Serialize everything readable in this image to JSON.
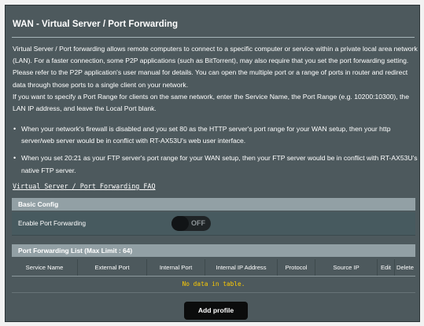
{
  "page": {
    "title": "WAN - Virtual Server / Port Forwarding",
    "description_1": "Virtual Server / Port forwarding allows remote computers to connect to a specific computer or service within a private local area network (LAN). For a faster connection, some P2P applications (such as BitTorrent), may also require that you set the port forwarding setting. Please refer to the P2P application's user manual for details. You can open the multiple port or a range of ports in router and redirect data through those ports to a single client on your network.",
    "description_2": "If you want to specify a Port Range for clients on the same network, enter the Service Name, the Port Range (e.g. 10200:10300), the LAN IP address, and leave the Local Port blank.",
    "bullets": [
      "When your network's firewall is disabled and you set 80 as the HTTP server's port range for your WAN setup, then your http server/web server would be in conflict with RT-AX53U's web user interface.",
      "When you set 20:21 as your FTP server's port range for your WAN setup, then your FTP server would be in conflict with RT-AX53U's native FTP server."
    ],
    "faq_link": "Virtual Server / Port Forwarding FAQ"
  },
  "basic_config": {
    "header": "Basic Config",
    "enable_label": "Enable Port Forwarding",
    "toggle_state": "OFF"
  },
  "list": {
    "header": "Port Forwarding List (Max Limit : 64)",
    "columns": [
      "Service Name",
      "External Port",
      "Internal Port",
      "Internal IP Address",
      "Protocol",
      "Source IP",
      "Edit",
      "Delete"
    ],
    "empty_message": "No data in table."
  },
  "actions": {
    "add_profile": "Add profile"
  },
  "colors": {
    "panel_bg": "#4d595d",
    "section_header_bg": "#92a0a5",
    "empty_message": "#ffcc00",
    "button_bg": "#0b0c0c"
  }
}
